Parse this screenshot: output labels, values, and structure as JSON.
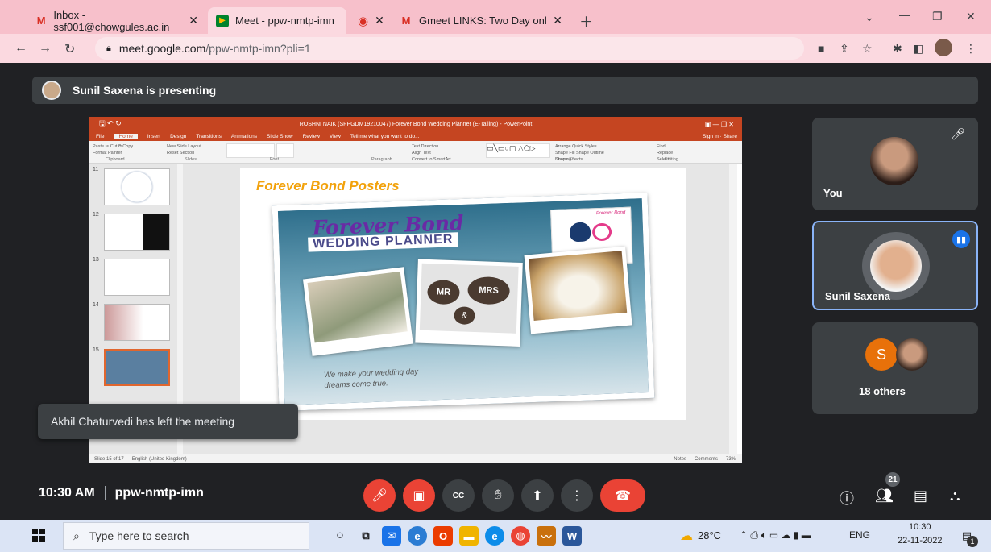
{
  "browser": {
    "tabs": [
      {
        "label": "Inbox - ssf001@chowgules.ac.in",
        "icon": "gmail-icon"
      },
      {
        "label": "Meet - ppw-nmtp-imn",
        "icon": "meet-icon"
      },
      {
        "label": "",
        "icon": "recording-icon"
      },
      {
        "label": "Gmeet LINKS: Two Day online FD",
        "icon": "gmail-icon"
      }
    ],
    "url_host": "meet.google.com",
    "url_path": "/ppw-nmtp-imn?pli=1"
  },
  "meet": {
    "presenting_banner": "Sunil Saxena is presenting",
    "toast": "Akhil Chaturvedi has left the meeting",
    "time": "10:30 AM",
    "meeting_code": "ppw-nmtp-imn",
    "participant_count": "21",
    "tiles": {
      "you_label": "You",
      "speaker_label": "Sunil Saxena",
      "others_initial": "S",
      "others_label": "18 others"
    }
  },
  "shared_screen": {
    "window_title": "ROSHNI NAIK (SFPGDM19210047) Forever Bond Wedding Planner (E-Tailing) - PowerPoint",
    "ribbon_tabs": [
      "File",
      "Home",
      "Insert",
      "Design",
      "Transitions",
      "Animations",
      "Slide Show",
      "Review",
      "View",
      "Tell me what you want to do..."
    ],
    "signin": "Sign in",
    "share": "Share",
    "ribbon_groups": [
      "Clipboard",
      "Slides",
      "Font",
      "Paragraph",
      "Drawing",
      "Editing"
    ],
    "ribbon_items": {
      "cut": "Cut",
      "copy": "Copy",
      "paste": "Paste",
      "format_painter": "Format Painter",
      "new_slide": "New Slide",
      "layout": "Layout",
      "reset": "Reset",
      "section": "Section",
      "text_direction": "Text Direction",
      "align_text": "Align Text",
      "smartart": "Convert to SmartArt",
      "arrange": "Arrange",
      "quick_styles": "Quick Styles",
      "shape_fill": "Shape Fill",
      "shape_outline": "Shape Outline",
      "shape_effects": "Shape Effects",
      "find": "Find",
      "replace": "Replace",
      "select": "Select"
    },
    "slide_numbers": [
      "11",
      "12",
      "13",
      "14",
      "15"
    ],
    "slide_title": "Forever Bond Posters",
    "poster_brand_line1": "Forever Bond",
    "poster_brand_line2": "WEDDING PLANNER",
    "poster_tag_brand": "Forever Bond",
    "poster_tagline": "We make your wedding day dreams come true.",
    "photo_sign_1": "MR",
    "photo_sign_2": "MRS",
    "photo_sign_amp": "&",
    "status_slide": "Slide 15 of 17",
    "status_lang": "English (United Kingdom)",
    "status_notes": "Notes",
    "status_comments": "Comments",
    "zoom": "73%"
  },
  "taskbar": {
    "search_placeholder": "Type here to search",
    "weather": "28°C",
    "lang": "ENG",
    "clock_time": "10:30",
    "clock_date": "22-11-2022",
    "notification_count": "1"
  }
}
